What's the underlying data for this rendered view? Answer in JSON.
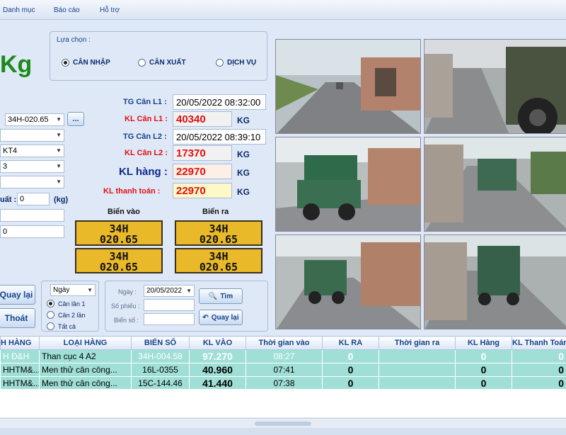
{
  "menu": [
    "Danh mục",
    "Báo cáo",
    "Hỗ trợ"
  ],
  "big_unit": "Kg",
  "selection": {
    "title": "Lựa chọn :",
    "options": [
      "CÂN NHẬP",
      "CÂN XUẤT",
      "DỊCH VỤ"
    ],
    "selected": "CÂN NHẬP"
  },
  "form": {
    "plate_value": "34H-020.65",
    "browse_label": "...",
    "combo_value_2": "",
    "combo_value_3": "KT4",
    "combo_value_4": "3",
    "combo_value_5": "",
    "deduct_label": "uất :",
    "deduct_value": "0",
    "deduct_unit": "(kg)",
    "text_value_1": "",
    "text_value_2": "0"
  },
  "weights": {
    "tg_l1_label": "TG Cân L1 :",
    "tg_l1_value": "20/05/2022 08:32:00",
    "kl_l1_label": "KL Cân L1 :",
    "kl_l1_value": "40340",
    "tg_l2_label": "TG Cân L2 :",
    "tg_l2_value": "20/05/2022 08:39:10",
    "kl_l2_label": "KL Cân L2 :",
    "kl_l2_value": "17370",
    "kl_hang_label": "KL hàng :",
    "kl_hang_value": "22970",
    "kl_tt_label": "KL thanh toán :",
    "kl_tt_value": "22970",
    "unit": "KG"
  },
  "plates": {
    "in_label": "Biển vào",
    "out_label": "Biển ra",
    "line1": "34H",
    "line2": "020.65"
  },
  "actions": {
    "back_label": "Quay lại",
    "exit_label": "Thoát"
  },
  "filter": {
    "period_value": "Ngày",
    "options": [
      "Cân lần 1",
      "Cân 2 lần",
      "Tất cả"
    ],
    "selected": "Cân lần 1",
    "date_label": "Ngày :",
    "date_value": "20/05/2022",
    "ticket_label": "Số phiếu :",
    "plate_label": "Biển số :",
    "search_label": "Tìm",
    "back_label": "Quay lại"
  },
  "table": {
    "headers": [
      "H HÀNG",
      "LOẠI HÀNG",
      "BIỂN SỐ",
      "KL VÀO",
      "Thời gian vào",
      "KL RA",
      "Thời gian ra",
      "KL Hàng",
      "KL Thanh Toán"
    ],
    "rows": [
      [
        "H Đ&H",
        "Than cục 4 A2",
        "34H-004.58",
        "97.270",
        "08:27",
        "0",
        "",
        "0",
        "0"
      ],
      [
        "HHTM&...",
        "Men thử cân công...",
        "16L-0355",
        "40.960",
        "07:41",
        "0",
        "",
        "0",
        "0"
      ],
      [
        "HHTM&...",
        "Men thử cân công...",
        "15C-144.46",
        "41.440",
        "07:38",
        "0",
        "",
        "0",
        "0"
      ]
    ]
  },
  "colors": {
    "red_value": "#e01010",
    "green_value": "#1a8a1a",
    "row_bg": "#9fdfd6",
    "plate_yellow": "#e9b92a"
  }
}
